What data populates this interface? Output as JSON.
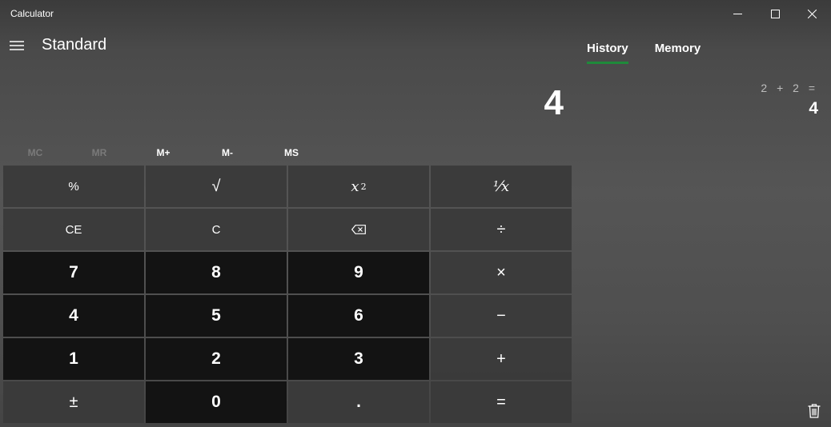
{
  "window": {
    "title": "Calculator",
    "minimize_glyph": "—",
    "close_glyph": "✕"
  },
  "header": {
    "mode": "Standard"
  },
  "display": {
    "value": "4"
  },
  "memory": {
    "buttons": [
      {
        "label": "MC",
        "enabled": false
      },
      {
        "label": "MR",
        "enabled": false
      },
      {
        "label": "M+",
        "enabled": true
      },
      {
        "label": "M-",
        "enabled": true
      },
      {
        "label": "MS",
        "enabled": true
      }
    ]
  },
  "keys": {
    "percent": "%",
    "sqrt": "√",
    "square_base": "x",
    "square_exp": "2",
    "reciprocal": "⅟x",
    "ce": "CE",
    "c": "C",
    "divide": "÷",
    "seven": "7",
    "eight": "8",
    "nine": "9",
    "multiply": "×",
    "four": "4",
    "five": "5",
    "six": "6",
    "minus": "−",
    "one": "1",
    "two": "2",
    "three": "3",
    "plus": "+",
    "negate": "±",
    "zero": "0",
    "decimal": ".",
    "equals": "="
  },
  "panel": {
    "tabs": [
      {
        "label": "History",
        "active": true
      },
      {
        "label": "Memory",
        "active": false
      }
    ],
    "history": [
      {
        "expression": "2 + 2 =",
        "result": "4"
      }
    ]
  },
  "colors": {
    "accent": "#1f8a3a",
    "number_key": "#131313",
    "function_key": "#3a3a3a"
  },
  "icons": {
    "menu": "hamburger-icon",
    "backspace": "backspace-icon",
    "trash": "trash-icon"
  }
}
